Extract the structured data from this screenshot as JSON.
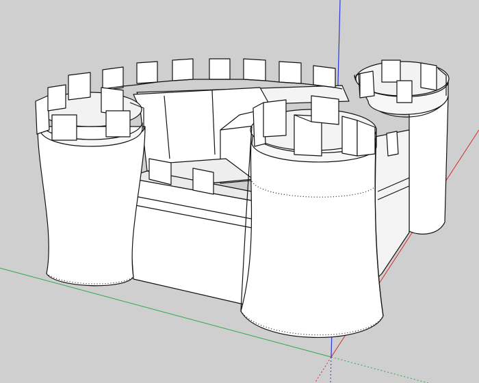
{
  "app": {
    "window_title": ""
  },
  "viewport": {
    "background": "#cfcfcf",
    "axis_colors": {
      "red": "#d02a2a",
      "green": "#2aa84a",
      "blue": "#2a35d8"
    },
    "model": {
      "name": "castle",
      "fill": "#ffffff",
      "shade": "#f1f1f1",
      "shadow": "#dcdcdc",
      "edge": "#111111"
    }
  }
}
